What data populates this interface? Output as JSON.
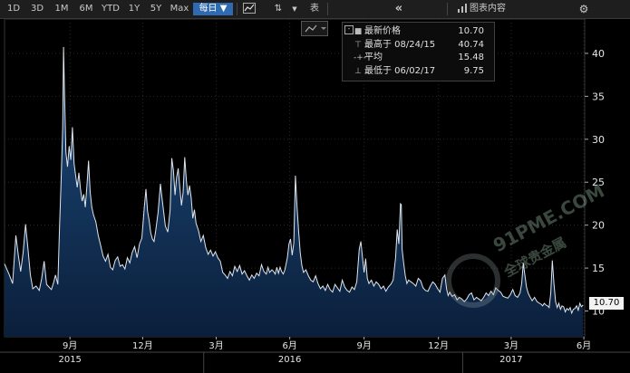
{
  "toolbar": {
    "ranges": [
      "1D",
      "3D",
      "1M",
      "6M",
      "YTD",
      "1Y",
      "5Y",
      "Max"
    ],
    "frequency_label": "每日 ▼",
    "style_label": "表",
    "collapse_glyph": "«",
    "chart_content_label": "图表内容",
    "settings_glyph": "⚙"
  },
  "legend": {
    "items": [
      {
        "symbol": "■",
        "label": "最新价格",
        "value": "10.70"
      },
      {
        "symbol": "⊤",
        "label": "最高于 08/24/15",
        "value": "40.74"
      },
      {
        "symbol": "-+-",
        "label": "平均",
        "value": "15.48"
      },
      {
        "symbol": "⊥",
        "label": "最低于 06/02/17",
        "value": "9.75"
      }
    ]
  },
  "last_price_tag": "10.70",
  "watermark": {
    "line1": "91PME.COM",
    "line2": "全球贵金属"
  },
  "chart_data": {
    "type": "area",
    "ylim": [
      7,
      44
    ],
    "yticks": [
      10,
      15,
      20,
      25,
      30,
      35,
      40
    ],
    "x_labels": [
      {
        "label": "9月",
        "t": 81
      },
      {
        "label": "12月",
        "t": 171
      },
      {
        "label": "3月",
        "t": 262
      },
      {
        "label": "6月",
        "t": 353
      },
      {
        "label": "9月",
        "t": 445
      },
      {
        "label": "12月",
        "t": 537
      },
      {
        "label": "3月",
        "t": 627
      },
      {
        "label": "6月",
        "t": 717
      }
    ],
    "year_labels": [
      {
        "label": "2015",
        "t": 81
      },
      {
        "label": "2016",
        "t": 353
      },
      {
        "label": "2017",
        "t": 627
      }
    ],
    "x_range": [
      0,
      718
    ],
    "colors": {
      "line": "#dfe6ee",
      "fill_top": "#1d4c7e",
      "fill_bottom": "#0b1f3b",
      "grid": "#2a2a2a"
    },
    "series": [
      {
        "values": [
          [
            0,
            15.5
          ],
          [
            6,
            14.2
          ],
          [
            10,
            13.2
          ],
          [
            14,
            18.8
          ],
          [
            17,
            16.5
          ],
          [
            20,
            14.6
          ],
          [
            23,
            16.8
          ],
          [
            26,
            20.1
          ],
          [
            29,
            17.3
          ],
          [
            32,
            14.2
          ],
          [
            35,
            12.6
          ],
          [
            39,
            12.9
          ],
          [
            43,
            12.4
          ],
          [
            46,
            13.8
          ],
          [
            49,
            15.8
          ],
          [
            52,
            13.1
          ],
          [
            55,
            12.8
          ],
          [
            58,
            12.5
          ],
          [
            61,
            13.4
          ],
          [
            63,
            14.2
          ],
          [
            66,
            13.1
          ],
          [
            68,
            19.5
          ],
          [
            70,
            25.1
          ],
          [
            72,
            31.5
          ],
          [
            73,
            40.74
          ],
          [
            74,
            36.2
          ],
          [
            76,
            28.5
          ],
          [
            78,
            26.8
          ],
          [
            80,
            29.2
          ],
          [
            82,
            27.6
          ],
          [
            84,
            31.4
          ],
          [
            86,
            27.2
          ],
          [
            88,
            25.8
          ],
          [
            90,
            24.4
          ],
          [
            92,
            26.1
          ],
          [
            94,
            24.2
          ],
          [
            96,
            22.8
          ],
          [
            98,
            23.6
          ],
          [
            100,
            22.1
          ],
          [
            102,
            24.6
          ],
          [
            104,
            27.5
          ],
          [
            106,
            23.8
          ],
          [
            108,
            22.1
          ],
          [
            110,
            21.2
          ],
          [
            113,
            20.4
          ],
          [
            116,
            18.8
          ],
          [
            119,
            17.6
          ],
          [
            122,
            16.4
          ],
          [
            125,
            15.8
          ],
          [
            128,
            16.6
          ],
          [
            131,
            15.1
          ],
          [
            134,
            14.8
          ],
          [
            137,
            15.9
          ],
          [
            140,
            16.3
          ],
          [
            143,
            15.2
          ],
          [
            146,
            15.4
          ],
          [
            149,
            14.9
          ],
          [
            152,
            16.2
          ],
          [
            155,
            15.6
          ],
          [
            158,
            16.8
          ],
          [
            161,
            17.5
          ],
          [
            164,
            16.2
          ],
          [
            167,
            17.8
          ],
          [
            170,
            18.5
          ],
          [
            173,
            22.1
          ],
          [
            175,
            24.2
          ],
          [
            177,
            21.6
          ],
          [
            179,
            20.5
          ],
          [
            181,
            19.1
          ],
          [
            183,
            18.4
          ],
          [
            185,
            18.1
          ],
          [
            187,
            19.3
          ],
          [
            190,
            21.5
          ],
          [
            193,
            24.8
          ],
          [
            195,
            23.1
          ],
          [
            197,
            21.5
          ],
          [
            199,
            19.9
          ],
          [
            202,
            19.2
          ],
          [
            205,
            21.8
          ],
          [
            207,
            27.8
          ],
          [
            209,
            26.4
          ],
          [
            211,
            23.5
          ],
          [
            213,
            25.6
          ],
          [
            215,
            26.6
          ],
          [
            217,
            24.4
          ],
          [
            219,
            22.3
          ],
          [
            221,
            23.8
          ],
          [
            223,
            27.9
          ],
          [
            225,
            25.2
          ],
          [
            227,
            23.5
          ],
          [
            229,
            24.6
          ],
          [
            231,
            23.2
          ],
          [
            233,
            20.8
          ],
          [
            235,
            21.8
          ],
          [
            237,
            20.2
          ],
          [
            240,
            19.4
          ],
          [
            243,
            18.1
          ],
          [
            246,
            18.8
          ],
          [
            249,
            17.4
          ],
          [
            252,
            16.6
          ],
          [
            255,
            17.1
          ],
          [
            258,
            16.4
          ],
          [
            261,
            16.9
          ],
          [
            264,
            16.2
          ],
          [
            267,
            15.8
          ],
          [
            270,
            14.5
          ],
          [
            273,
            14.2
          ],
          [
            276,
            13.8
          ],
          [
            279,
            14.6
          ],
          [
            282,
            14.1
          ],
          [
            285,
            15.2
          ],
          [
            288,
            14.6
          ],
          [
            291,
            15.3
          ],
          [
            294,
            14.3
          ],
          [
            297,
            14.7
          ],
          [
            300,
            14.1
          ],
          [
            303,
            13.6
          ],
          [
            306,
            14.2
          ],
          [
            309,
            13.8
          ],
          [
            312,
            14.4
          ],
          [
            315,
            14.1
          ],
          [
            318,
            15.4
          ],
          [
            321,
            14.6
          ],
          [
            324,
            14.3
          ],
          [
            326,
            15.1
          ],
          [
            328,
            14.5
          ],
          [
            331,
            14.8
          ],
          [
            333,
            14.6
          ],
          [
            335,
            14.3
          ],
          [
            337,
            15.1
          ],
          [
            339,
            14.4
          ],
          [
            341,
            15.1
          ],
          [
            343,
            14.6
          ],
          [
            345,
            14.3
          ],
          [
            347,
            14.8
          ],
          [
            350,
            16.2
          ],
          [
            352,
            17.8
          ],
          [
            354,
            18.4
          ],
          [
            356,
            16.5
          ],
          [
            358,
            17.9
          ],
          [
            360,
            25.76
          ],
          [
            362,
            22.1
          ],
          [
            364,
            19.2
          ],
          [
            366,
            16.8
          ],
          [
            368,
            15.3
          ],
          [
            370,
            14.5
          ],
          [
            373,
            14.8
          ],
          [
            376,
            14.1
          ],
          [
            379,
            13.6
          ],
          [
            382,
            13.4
          ],
          [
            385,
            14.1
          ],
          [
            388,
            13.2
          ],
          [
            391,
            12.6
          ],
          [
            394,
            12.9
          ],
          [
            397,
            12.4
          ],
          [
            400,
            13.1
          ],
          [
            403,
            12.5
          ],
          [
            406,
            12.2
          ],
          [
            409,
            13.1
          ],
          [
            412,
            12.7
          ],
          [
            415,
            12.3
          ],
          [
            418,
            13.6
          ],
          [
            421,
            12.8
          ],
          [
            424,
            12.4
          ],
          [
            427,
            12.2
          ],
          [
            430,
            12.8
          ],
          [
            433,
            12.5
          ],
          [
            436,
            13.4
          ],
          [
            439,
            17.2
          ],
          [
            441,
            18.1
          ],
          [
            443,
            16.2
          ],
          [
            445,
            14.5
          ],
          [
            447,
            16.1
          ],
          [
            449,
            13.8
          ],
          [
            451,
            13.2
          ],
          [
            454,
            13.6
          ],
          [
            457,
            12.9
          ],
          [
            460,
            13.4
          ],
          [
            463,
            13.1
          ],
          [
            466,
            12.6
          ],
          [
            469,
            12.9
          ],
          [
            472,
            12.3
          ],
          [
            475,
            12.8
          ],
          [
            478,
            13.1
          ],
          [
            481,
            13.6
          ],
          [
            484,
            16.2
          ],
          [
            486,
            19.5
          ],
          [
            488,
            17.8
          ],
          [
            490,
            22.5
          ],
          [
            491,
            22.4
          ],
          [
            492,
            17.2
          ],
          [
            494,
            15.6
          ],
          [
            496,
            14.1
          ],
          [
            498,
            13.2
          ],
          [
            500,
            13.6
          ],
          [
            503,
            13.4
          ],
          [
            506,
            13.2
          ],
          [
            509,
            12.9
          ],
          [
            512,
            13.8
          ],
          [
            515,
            13.5
          ],
          [
            518,
            12.7
          ],
          [
            521,
            12.4
          ],
          [
            524,
            12.3
          ],
          [
            527,
            12.9
          ],
          [
            530,
            13.4
          ],
          [
            533,
            13.1
          ],
          [
            536,
            12.6
          ],
          [
            539,
            12.2
          ],
          [
            542,
            13.8
          ],
          [
            545,
            14.2
          ],
          [
            547,
            12.6
          ],
          [
            549,
            11.8
          ],
          [
            551,
            12.2
          ],
          [
            554,
            11.7
          ],
          [
            557,
            11.9
          ],
          [
            560,
            11.3
          ],
          [
            563,
            11.6
          ],
          [
            566,
            11.4
          ],
          [
            569,
            11.1
          ],
          [
            572,
            11.4
          ],
          [
            575,
            11.9
          ],
          [
            578,
            12.1
          ],
          [
            581,
            11.3
          ],
          [
            584,
            11.6
          ],
          [
            587,
            11.4
          ],
          [
            590,
            11.2
          ],
          [
            593,
            11.6
          ],
          [
            596,
            12.1
          ],
          [
            599,
            11.8
          ],
          [
            602,
            12.3
          ],
          [
            605,
            11.9
          ],
          [
            608,
            12.7
          ],
          [
            611,
            12.4
          ],
          [
            614,
            12.2
          ],
          [
            617,
            11.7
          ],
          [
            620,
            11.6
          ],
          [
            623,
            11.5
          ],
          [
            626,
            11.9
          ],
          [
            629,
            12.5
          ],
          [
            632,
            11.8
          ],
          [
            635,
            11.6
          ],
          [
            638,
            12.1
          ],
          [
            640,
            13.2
          ],
          [
            642,
            15.6
          ],
          [
            644,
            14.2
          ],
          [
            646,
            12.8
          ],
          [
            648,
            12.1
          ],
          [
            650,
            11.7
          ],
          [
            653,
            11.2
          ],
          [
            656,
            11.6
          ],
          [
            659,
            11.1
          ],
          [
            662,
            10.9
          ],
          [
            664,
            10.8
          ],
          [
            666,
            10.6
          ],
          [
            668,
            10.9
          ],
          [
            670,
            10.7
          ],
          [
            672,
            10.6
          ],
          [
            674,
            10.4
          ],
          [
            676,
            12.1
          ],
          [
            678,
            15.9
          ],
          [
            680,
            13.2
          ],
          [
            682,
            11.1
          ],
          [
            684,
            10.4
          ],
          [
            686,
            10.9
          ],
          [
            688,
            10.2
          ],
          [
            690,
            10.6
          ],
          [
            692,
            10.5
          ],
          [
            694,
            9.9
          ],
          [
            696,
            10.3
          ],
          [
            698,
            10.1
          ],
          [
            700,
            10.4
          ],
          [
            702,
            9.75
          ],
          [
            704,
            10.2
          ],
          [
            706,
            10.3
          ],
          [
            708,
            10.6
          ],
          [
            710,
            10.1
          ],
          [
            712,
            10.9
          ],
          [
            714,
            10.5
          ],
          [
            716,
            10.7
          ]
        ]
      }
    ]
  }
}
